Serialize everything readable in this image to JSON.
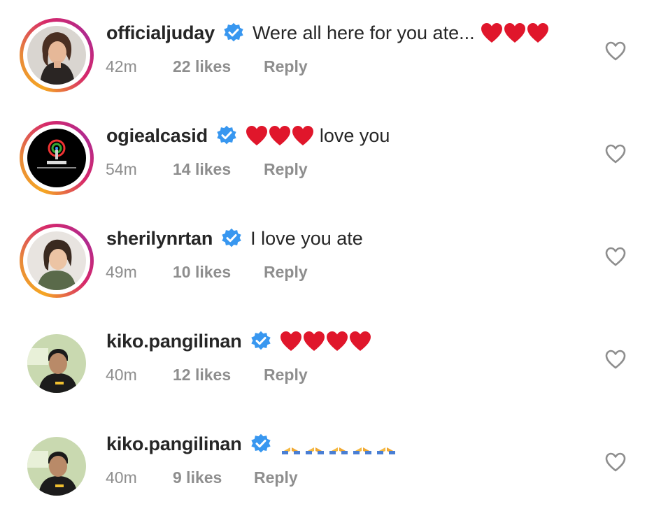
{
  "comments": [
    {
      "username": "officialjuday",
      "text": "Were all here for you ate...",
      "emoji": "hearts",
      "count": 3,
      "emoji_after_text": true,
      "time": "42m",
      "likes": "22 likes",
      "reply": "Reply",
      "ring": true,
      "avatar": "woman-portrait"
    },
    {
      "username": "ogiealcasid",
      "text": "love you",
      "emoji": "hearts",
      "count": 3,
      "emoji_after_text": false,
      "time": "54m",
      "likes": "14 likes",
      "reply": "Reply",
      "ring": true,
      "avatar": "abs-cbn-logo"
    },
    {
      "username": "sherilynrtan",
      "text": "I love you ate",
      "emoji": "",
      "count": 0,
      "emoji_after_text": true,
      "time": "49m",
      "likes": "10 likes",
      "reply": "Reply",
      "ring": true,
      "avatar": "woman-portrait"
    },
    {
      "username": "kiko.pangilinan",
      "text": "",
      "emoji": "hearts",
      "count": 4,
      "emoji_after_text": true,
      "time": "40m",
      "likes": "12 likes",
      "reply": "Reply",
      "ring": false,
      "avatar": "man-portrait"
    },
    {
      "username": "kiko.pangilinan",
      "text": "",
      "emoji": "pray",
      "count": 5,
      "emoji_after_text": true,
      "time": "40m",
      "likes": "9 likes",
      "reply": "Reply",
      "ring": false,
      "avatar": "man-portrait"
    }
  ],
  "colors": {
    "verified": "#3897f0",
    "heart_emoji": "#e0162b",
    "meta_text": "#8e8e8e",
    "username": "#262626"
  }
}
